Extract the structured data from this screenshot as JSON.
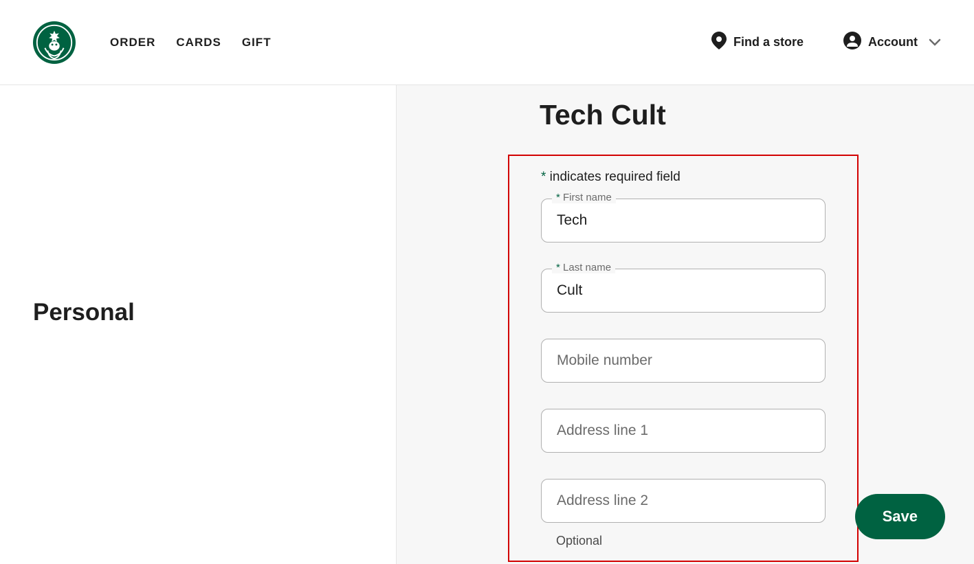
{
  "header": {
    "nav": [
      "ORDER",
      "CARDS",
      "GIFT"
    ],
    "find_store": "Find a store",
    "account": "Account"
  },
  "left": {
    "title": "Personal"
  },
  "page": {
    "title": "Tech Cult",
    "required_note_prefix": "*",
    "required_note_text": " indicates required field",
    "fields": {
      "first_name_label": "First name",
      "first_name_value": "Tech",
      "last_name_label": "Last name",
      "last_name_value": "Cult",
      "mobile_placeholder": "Mobile number",
      "address1_placeholder": "Address line 1",
      "address2_placeholder": "Address line 2",
      "address2_helper": "Optional"
    },
    "save_label": "Save"
  }
}
